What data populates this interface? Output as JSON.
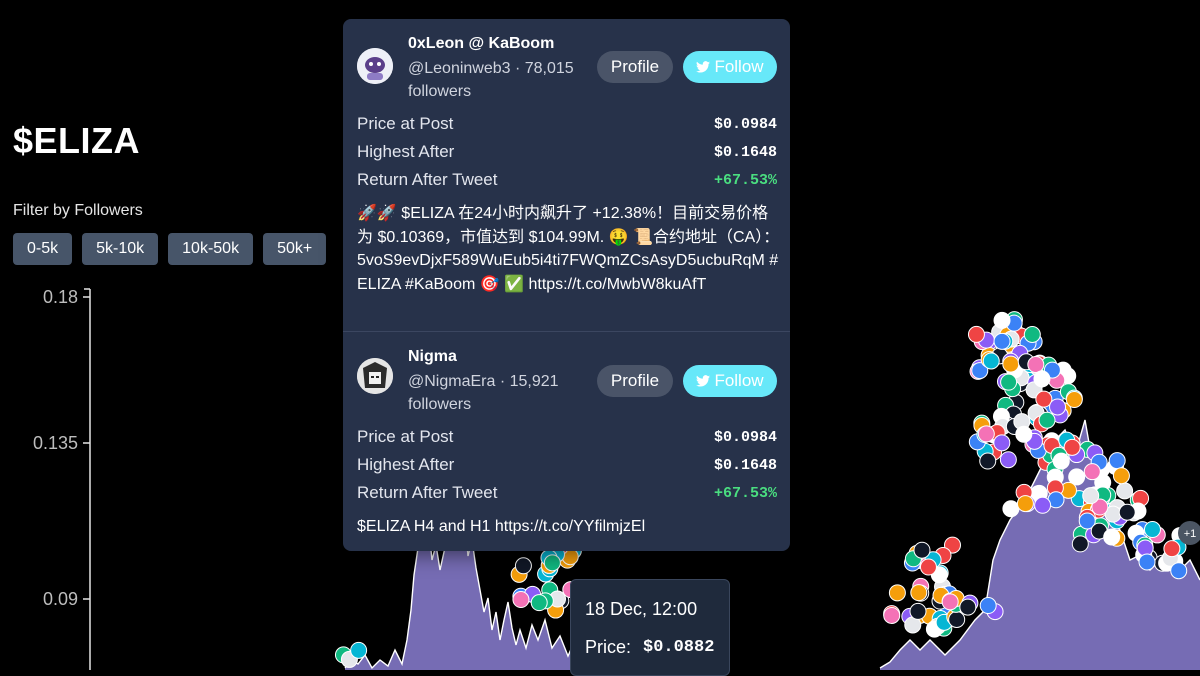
{
  "token": {
    "title": "$ELIZA"
  },
  "filter": {
    "label": "Filter by Followers",
    "options": [
      "0-5k",
      "5k-10k",
      "10k-50k",
      "50k+"
    ]
  },
  "chart_data": {
    "type": "area",
    "y_ticks": [
      "0.18",
      "0.135",
      "0.09"
    ],
    "ylim": [
      0.045,
      0.18
    ],
    "area_color": "#8b7fd4",
    "marker_overflow_label": "+1"
  },
  "posts": [
    {
      "name": "0xLeon @ KaBoom",
      "handle": "@Leoninweb3 · 78,015 followers",
      "profile_label": "Profile",
      "follow_label": "Follow",
      "stats": [
        {
          "label": "Price at Post",
          "value": "$0.0984",
          "positive": false
        },
        {
          "label": "Highest After",
          "value": "$0.1648",
          "positive": false
        },
        {
          "label": "Return After Tweet",
          "value": "+67.53%",
          "positive": true
        }
      ],
      "text": "🚀🚀 $ELIZA 在24小时内飙升了 +12.38%！目前交易价格为 $0.10369，市值达到 $104.99M. 🤑 📜合约地址（CA）：5voS9evDjxF589WuEub5i4ti7FWQmZCsAsyD5ucbuRqM #ELIZA #KaBoom 🎯 ✅ https://t.co/MwbW8kuAfT"
    },
    {
      "name": "Nigma",
      "handle": "@NigmaEra · 15,921 followers",
      "profile_label": "Profile",
      "follow_label": "Follow",
      "stats": [
        {
          "label": "Price at Post",
          "value": "$0.0984",
          "positive": false
        },
        {
          "label": "Highest After",
          "value": "$0.1648",
          "positive": false
        },
        {
          "label": "Return After Tweet",
          "value": "+67.53%",
          "positive": true
        }
      ],
      "text": "$ELIZA H4 and H1 https://t.co/YYfilmjzEl"
    }
  ],
  "tooltip": {
    "date": "18 Dec, 12:00",
    "price_label": "Price:",
    "price_value": "$0.0882"
  },
  "colors": {
    "background": "#000000",
    "popup": "#27324a",
    "follow": "#67e8f9",
    "positive": "#4ade80",
    "filter_button": "#475569"
  }
}
